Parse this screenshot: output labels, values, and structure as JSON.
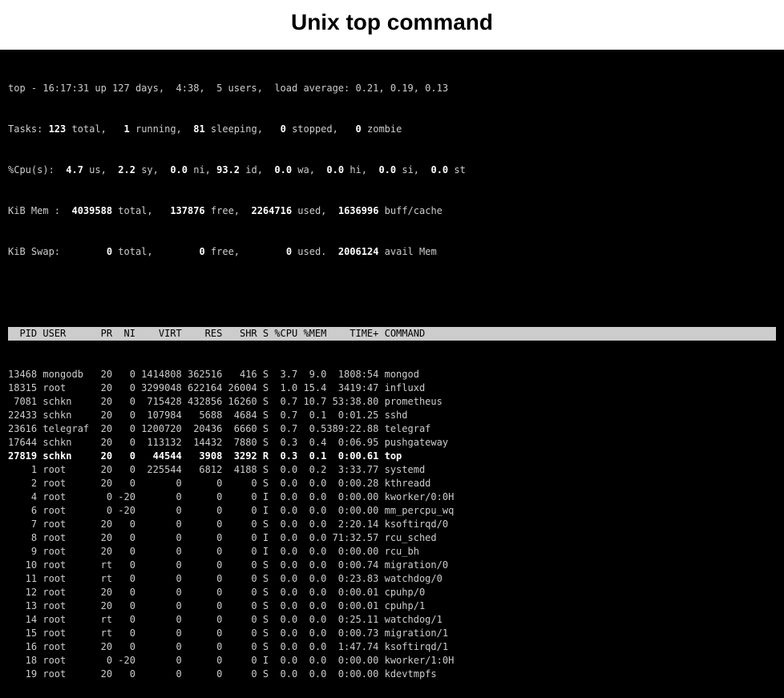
{
  "title": "Unix top command",
  "summary": {
    "line1": "top - 16:17:31 up 127 days,  4:38,  5 users,  load average: 0.21, 0.19, 0.13",
    "line2_a": "Tasks: ",
    "line2_b": "123 ",
    "line2_c": "total,   ",
    "line2_d": "1 ",
    "line2_e": "running,  ",
    "line2_f": "81 ",
    "line2_g": "sleeping,   ",
    "line2_h": "0 ",
    "line2_i": "stopped,   ",
    "line2_j": "0 ",
    "line2_k": "zombie",
    "line3_a": "%Cpu(s):  ",
    "line3_b": "4.7 ",
    "line3_c": "us,  ",
    "line3_d": "2.2 ",
    "line3_e": "sy,  ",
    "line3_f": "0.0 ",
    "line3_g": "ni, ",
    "line3_h": "93.2 ",
    "line3_i": "id,  ",
    "line3_j": "0.0 ",
    "line3_k": "wa,  ",
    "line3_l": "0.0 ",
    "line3_m": "hi,  ",
    "line3_n": "0.0 ",
    "line3_o": "si,  ",
    "line3_p": "0.0 ",
    "line3_q": "st",
    "line4_a": "KiB Mem :  ",
    "line4_b": "4039588 ",
    "line4_c": "total,   ",
    "line4_d": "137876 ",
    "line4_e": "free,  ",
    "line4_f": "2264716 ",
    "line4_g": "used,  ",
    "line4_h": "1636996 ",
    "line4_i": "buff/cache",
    "line5_a": "KiB Swap:        ",
    "line5_b": "0 ",
    "line5_c": "total,        ",
    "line5_d": "0 ",
    "line5_e": "free,        ",
    "line5_f": "0 ",
    "line5_g": "used.  ",
    "line5_h": "2006124 ",
    "line5_i": "avail Mem"
  },
  "columns": [
    "PID",
    "USER",
    "PR",
    "NI",
    "VIRT",
    "RES",
    "SHR",
    "S",
    "%CPU",
    "%MEM",
    "TIME+",
    "COMMAND"
  ],
  "processes": [
    {
      "pid": "13468",
      "user": "mongodb",
      "pr": "20",
      "ni": "0",
      "virt": "1414808",
      "res": "362516",
      "shr": "416",
      "s": "S",
      "cpu": "3.7",
      "mem": "9.0",
      "time": "1808:54",
      "cmd": "mongod",
      "bold": false
    },
    {
      "pid": "18315",
      "user": "root",
      "pr": "20",
      "ni": "0",
      "virt": "3299048",
      "res": "622164",
      "shr": "26004",
      "s": "S",
      "cpu": "1.0",
      "mem": "15.4",
      "time": "3419:47",
      "cmd": "influxd",
      "bold": false
    },
    {
      "pid": "7081",
      "user": "schkn",
      "pr": "20",
      "ni": "0",
      "virt": "715428",
      "res": "432856",
      "shr": "16260",
      "s": "S",
      "cpu": "0.7",
      "mem": "10.7",
      "time": "53:38.80",
      "cmd": "prometheus",
      "bold": false
    },
    {
      "pid": "22433",
      "user": "schkn",
      "pr": "20",
      "ni": "0",
      "virt": "107984",
      "res": "5688",
      "shr": "4684",
      "s": "S",
      "cpu": "0.7",
      "mem": "0.1",
      "time": "0:01.25",
      "cmd": "sshd",
      "bold": false
    },
    {
      "pid": "23616",
      "user": "telegraf",
      "pr": "20",
      "ni": "0",
      "virt": "1200720",
      "res": "20436",
      "shr": "6660",
      "s": "S",
      "cpu": "0.7",
      "mem": "0.5",
      "time": "389:22.88",
      "cmd": "telegraf",
      "bold": false
    },
    {
      "pid": "17644",
      "user": "schkn",
      "pr": "20",
      "ni": "0",
      "virt": "113132",
      "res": "14432",
      "shr": "7880",
      "s": "S",
      "cpu": "0.3",
      "mem": "0.4",
      "time": "0:06.95",
      "cmd": "pushgateway",
      "bold": false
    },
    {
      "pid": "27819",
      "user": "schkn",
      "pr": "20",
      "ni": "0",
      "virt": "44544",
      "res": "3908",
      "shr": "3292",
      "s": "R",
      "cpu": "0.3",
      "mem": "0.1",
      "time": "0:00.61",
      "cmd": "top",
      "bold": true
    },
    {
      "pid": "1",
      "user": "root",
      "pr": "20",
      "ni": "0",
      "virt": "225544",
      "res": "6812",
      "shr": "4188",
      "s": "S",
      "cpu": "0.0",
      "mem": "0.2",
      "time": "3:33.77",
      "cmd": "systemd",
      "bold": false
    },
    {
      "pid": "2",
      "user": "root",
      "pr": "20",
      "ni": "0",
      "virt": "0",
      "res": "0",
      "shr": "0",
      "s": "S",
      "cpu": "0.0",
      "mem": "0.0",
      "time": "0:00.28",
      "cmd": "kthreadd",
      "bold": false
    },
    {
      "pid": "4",
      "user": "root",
      "pr": "0",
      "ni": "-20",
      "virt": "0",
      "res": "0",
      "shr": "0",
      "s": "I",
      "cpu": "0.0",
      "mem": "0.0",
      "time": "0:00.00",
      "cmd": "kworker/0:0H",
      "bold": false
    },
    {
      "pid": "6",
      "user": "root",
      "pr": "0",
      "ni": "-20",
      "virt": "0",
      "res": "0",
      "shr": "0",
      "s": "I",
      "cpu": "0.0",
      "mem": "0.0",
      "time": "0:00.00",
      "cmd": "mm_percpu_wq",
      "bold": false
    },
    {
      "pid": "7",
      "user": "root",
      "pr": "20",
      "ni": "0",
      "virt": "0",
      "res": "0",
      "shr": "0",
      "s": "S",
      "cpu": "0.0",
      "mem": "0.0",
      "time": "2:20.14",
      "cmd": "ksoftirqd/0",
      "bold": false
    },
    {
      "pid": "8",
      "user": "root",
      "pr": "20",
      "ni": "0",
      "virt": "0",
      "res": "0",
      "shr": "0",
      "s": "I",
      "cpu": "0.0",
      "mem": "0.0",
      "time": "71:32.57",
      "cmd": "rcu_sched",
      "bold": false
    },
    {
      "pid": "9",
      "user": "root",
      "pr": "20",
      "ni": "0",
      "virt": "0",
      "res": "0",
      "shr": "0",
      "s": "I",
      "cpu": "0.0",
      "mem": "0.0",
      "time": "0:00.00",
      "cmd": "rcu_bh",
      "bold": false
    },
    {
      "pid": "10",
      "user": "root",
      "pr": "rt",
      "ni": "0",
      "virt": "0",
      "res": "0",
      "shr": "0",
      "s": "S",
      "cpu": "0.0",
      "mem": "0.0",
      "time": "0:00.74",
      "cmd": "migration/0",
      "bold": false
    },
    {
      "pid": "11",
      "user": "root",
      "pr": "rt",
      "ni": "0",
      "virt": "0",
      "res": "0",
      "shr": "0",
      "s": "S",
      "cpu": "0.0",
      "mem": "0.0",
      "time": "0:23.83",
      "cmd": "watchdog/0",
      "bold": false
    },
    {
      "pid": "12",
      "user": "root",
      "pr": "20",
      "ni": "0",
      "virt": "0",
      "res": "0",
      "shr": "0",
      "s": "S",
      "cpu": "0.0",
      "mem": "0.0",
      "time": "0:00.01",
      "cmd": "cpuhp/0",
      "bold": false
    },
    {
      "pid": "13",
      "user": "root",
      "pr": "20",
      "ni": "0",
      "virt": "0",
      "res": "0",
      "shr": "0",
      "s": "S",
      "cpu": "0.0",
      "mem": "0.0",
      "time": "0:00.01",
      "cmd": "cpuhp/1",
      "bold": false
    },
    {
      "pid": "14",
      "user": "root",
      "pr": "rt",
      "ni": "0",
      "virt": "0",
      "res": "0",
      "shr": "0",
      "s": "S",
      "cpu": "0.0",
      "mem": "0.0",
      "time": "0:25.11",
      "cmd": "watchdog/1",
      "bold": false
    },
    {
      "pid": "15",
      "user": "root",
      "pr": "rt",
      "ni": "0",
      "virt": "0",
      "res": "0",
      "shr": "0",
      "s": "S",
      "cpu": "0.0",
      "mem": "0.0",
      "time": "0:00.73",
      "cmd": "migration/1",
      "bold": false
    },
    {
      "pid": "16",
      "user": "root",
      "pr": "20",
      "ni": "0",
      "virt": "0",
      "res": "0",
      "shr": "0",
      "s": "S",
      "cpu": "0.0",
      "mem": "0.0",
      "time": "1:47.74",
      "cmd": "ksoftirqd/1",
      "bold": false
    },
    {
      "pid": "18",
      "user": "root",
      "pr": "0",
      "ni": "-20",
      "virt": "0",
      "res": "0",
      "shr": "0",
      "s": "I",
      "cpu": "0.0",
      "mem": "0.0",
      "time": "0:00.00",
      "cmd": "kworker/1:0H",
      "bold": false
    },
    {
      "pid": "19",
      "user": "root",
      "pr": "20",
      "ni": "0",
      "virt": "0",
      "res": "0",
      "shr": "0",
      "s": "S",
      "cpu": "0.0",
      "mem": "0.0",
      "time": "0:00.00",
      "cmd": "kdevtmpfs",
      "bold": false
    }
  ]
}
